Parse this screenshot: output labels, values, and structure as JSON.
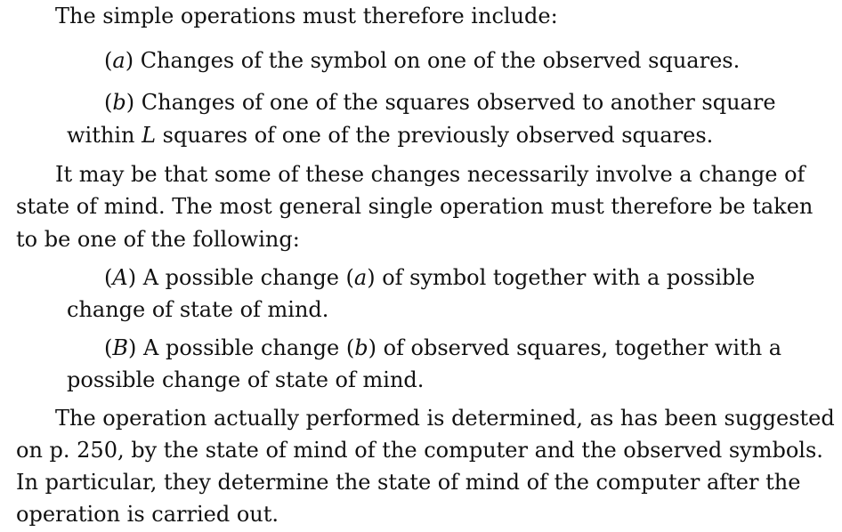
{
  "document": {
    "intro": "The simple operations must therefore include:",
    "item_a": {
      "marker_open": "(",
      "marker_letter": "a",
      "marker_close": ")",
      "text": " Changes of the symbol on one of the observed squares."
    },
    "item_b": {
      "marker_open": "(",
      "marker_letter": "b",
      "marker_close": ")",
      "line1": " Changes of one of the squares observed to another square",
      "line2_pre": "within ",
      "line2_var": "L",
      "line2_post": " squares of one of the previously observed squares."
    },
    "para_change": {
      "line1": "It may be that some of these changes necessarily involve a change of",
      "line2": "state of mind.  The most general single operation must therefore be taken",
      "line3": "to be one of the following:"
    },
    "item_A": {
      "marker_open": "(",
      "marker_letter": "A",
      "marker_close": ")",
      "line1_pre": " A possible change (",
      "line1_var": "a",
      "line1_post": ") of symbol together with a possible",
      "line2": "change of state of mind."
    },
    "item_B": {
      "marker_open": "(",
      "marker_letter": "B",
      "marker_close": ")",
      "line1_pre": " A possible change (",
      "line1_var": "b",
      "line1_post": ") of observed squares, together with a",
      "line2": "possible change of state of mind."
    },
    "para_operation": {
      "line1": "The operation actually performed is determined, as has been suggested",
      "line2": "on p. 250, by the state of mind of the computer and the observed symbols.",
      "line3": "In particular, they determine the state of mind of the computer after the",
      "line4": "operation is carried out."
    }
  }
}
